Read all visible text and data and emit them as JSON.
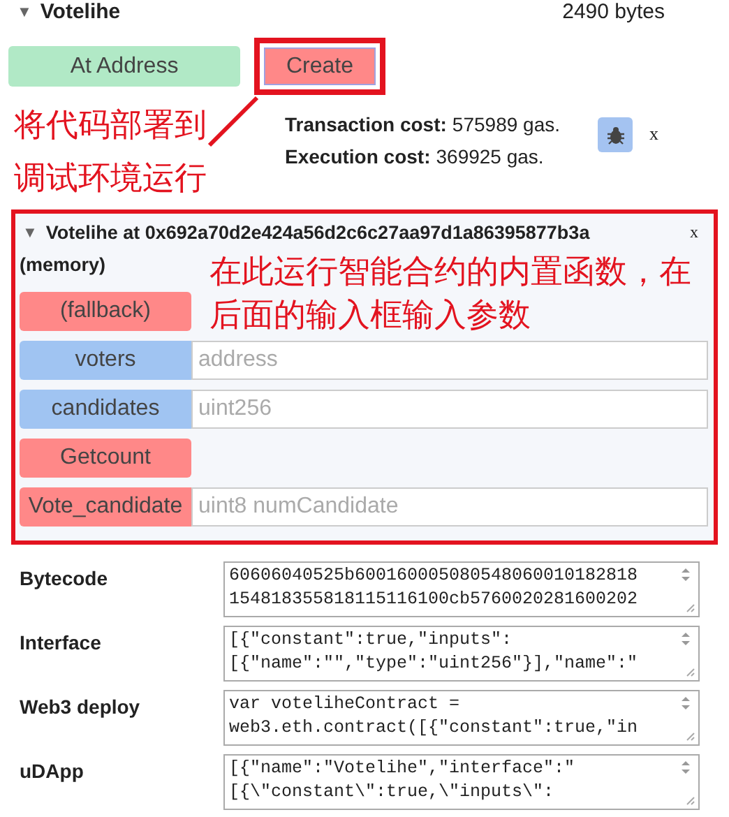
{
  "contract": {
    "toggle": "▼",
    "name": "Votelihe",
    "size": "2490 bytes",
    "at_address_button": "At Address",
    "create_button": "Create",
    "transaction_cost_label": "Transaction cost:",
    "transaction_cost_value": "575989 gas.",
    "execution_cost_label": "Execution cost:",
    "execution_cost_value": "369925 gas.",
    "close": "x"
  },
  "annotations": [
    "将代码部署到调试环境运行",
    "在此运行智能合约的内置函数，在后面的输入框输入参数"
  ],
  "instance": {
    "toggle": "▼",
    "title": "Votelihe at 0x692a70d2e424a56d2c6c27aa97d1a86395877b3a",
    "location": "(memory)",
    "close": "x",
    "functions": [
      {
        "name": "(fallback)",
        "kind": "transact"
      },
      {
        "name": "voters",
        "kind": "call",
        "placeholder": "address"
      },
      {
        "name": "candidates",
        "kind": "call",
        "placeholder": "uint256"
      },
      {
        "name": "Getcount",
        "kind": "transact"
      },
      {
        "name": "Vote_candidate",
        "kind": "transact",
        "placeholder": "uint8 numCandidate"
      }
    ]
  },
  "details": [
    {
      "label": "Bytecode",
      "lines": [
        "60606040525b600160005080548060010182818",
        "154818355818115116100cb5760020281600202"
      ]
    },
    {
      "label": "Interface",
      "lines": [
        "[{\"constant\":true,\"inputs\":",
        "[{\"name\":\"\",\"type\":\"uint256\"}],\"name\":\""
      ]
    },
    {
      "label": "Web3 deploy",
      "lines": [
        "var voteliheContract =",
        "web3.eth.contract([{\"constant\":true,\"in"
      ]
    },
    {
      "label": "uDApp",
      "lines": [
        "[{\"name\":\"Votelihe\",\"interface\":\"",
        "[{\\\"constant\\\":true,\\\"inputs\\\":"
      ]
    }
  ]
}
